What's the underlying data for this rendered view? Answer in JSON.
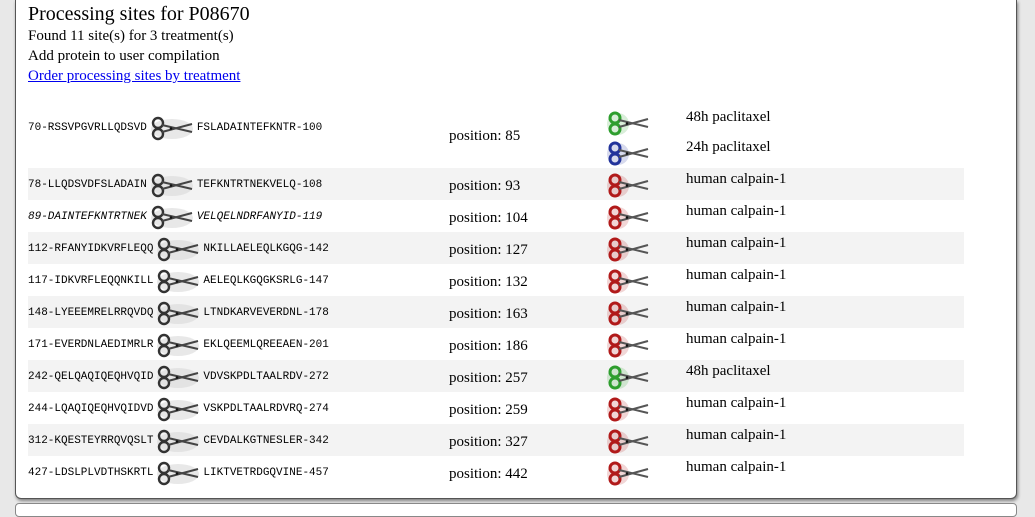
{
  "page": {
    "title": "Processing sites for P08670",
    "found_text": "Found 11 site(s) for 3 treatment(s)",
    "add_text": "Add protein to user compilation",
    "order_link": "Order processing sites by treatment"
  },
  "colors": {
    "green": "#2e9e2e",
    "blue": "#22339b",
    "red": "#b11a1a",
    "link": "#0000ee",
    "row_alt": "#f3f3f3"
  },
  "sites": [
    {
      "left": "70-RSSVPGVRLLQDSVD",
      "right": "FSLADAINTEFKNTR-100",
      "italic": false,
      "position": "position: 85",
      "treatments": [
        {
          "label": "48h paclitaxel",
          "icon": "green-scissors-icon",
          "color": "green"
        },
        {
          "label": "24h paclitaxel",
          "icon": "blue-scissors-icon",
          "color": "blue"
        }
      ]
    },
    {
      "left": "78-LLQDSVDFSLADAIN",
      "right": "TEFKNTRTNEKVELQ-108",
      "italic": false,
      "position": "position: 93",
      "treatments": [
        {
          "label": "human calpain-1",
          "icon": "red-scissors-icon",
          "color": "red"
        }
      ]
    },
    {
      "left": "89-DAINTEFKNTRTNEK",
      "right": "VELQELNDRFANYID-119",
      "italic": true,
      "position": "position: 104",
      "treatments": [
        {
          "label": "human calpain-1",
          "icon": "red-scissors-icon",
          "color": "red"
        }
      ]
    },
    {
      "left": "112-RFANYIDKVRFLEQQ",
      "right": "NKILLAELEQLKGQG-142",
      "italic": false,
      "position": "position: 127",
      "treatments": [
        {
          "label": "human calpain-1",
          "icon": "red-scissors-icon",
          "color": "red"
        }
      ]
    },
    {
      "left": "117-IDKVRFLEQQNKILL",
      "right": "AELEQLKGQGKSRLG-147",
      "italic": false,
      "position": "position: 132",
      "treatments": [
        {
          "label": "human calpain-1",
          "icon": "red-scissors-icon",
          "color": "red"
        }
      ]
    },
    {
      "left": "148-LYEEEMRELRRQVDQ",
      "right": "LTNDKARVEVERDNL-178",
      "italic": false,
      "position": "position: 163",
      "treatments": [
        {
          "label": "human calpain-1",
          "icon": "red-scissors-icon",
          "color": "red"
        }
      ]
    },
    {
      "left": "171-EVERDNLAEDIMRLR",
      "right": "EKLQEEMLQREEAEN-201",
      "italic": false,
      "position": "position: 186",
      "treatments": [
        {
          "label": "human calpain-1",
          "icon": "red-scissors-icon",
          "color": "red"
        }
      ]
    },
    {
      "left": "242-QELQAQIQEQHVQID",
      "right": "VDVSKPDLTAALRDV-272",
      "italic": false,
      "position": "position: 257",
      "treatments": [
        {
          "label": "48h paclitaxel",
          "icon": "green-scissors-icon",
          "color": "green"
        }
      ]
    },
    {
      "left": "244-LQAQIQEQHVQIDVD",
      "right": "VSKPDLTAALRDVRQ-274",
      "italic": false,
      "position": "position: 259",
      "treatments": [
        {
          "label": "human calpain-1",
          "icon": "red-scissors-icon",
          "color": "red"
        }
      ]
    },
    {
      "left": "312-KQESTEYRRQVQSLT",
      "right": "CEVDALKGTNESLER-342",
      "italic": false,
      "position": "position: 327",
      "treatments": [
        {
          "label": "human calpain-1",
          "icon": "red-scissors-icon",
          "color": "red"
        }
      ]
    },
    {
      "left": "427-LDSLPLVDTHSKRTL",
      "right": "LIKTVETRDGQVINE-457",
      "italic": false,
      "position": "position: 442",
      "treatments": [
        {
          "label": "human calpain-1",
          "icon": "red-scissors-icon",
          "color": "red"
        }
      ]
    }
  ]
}
